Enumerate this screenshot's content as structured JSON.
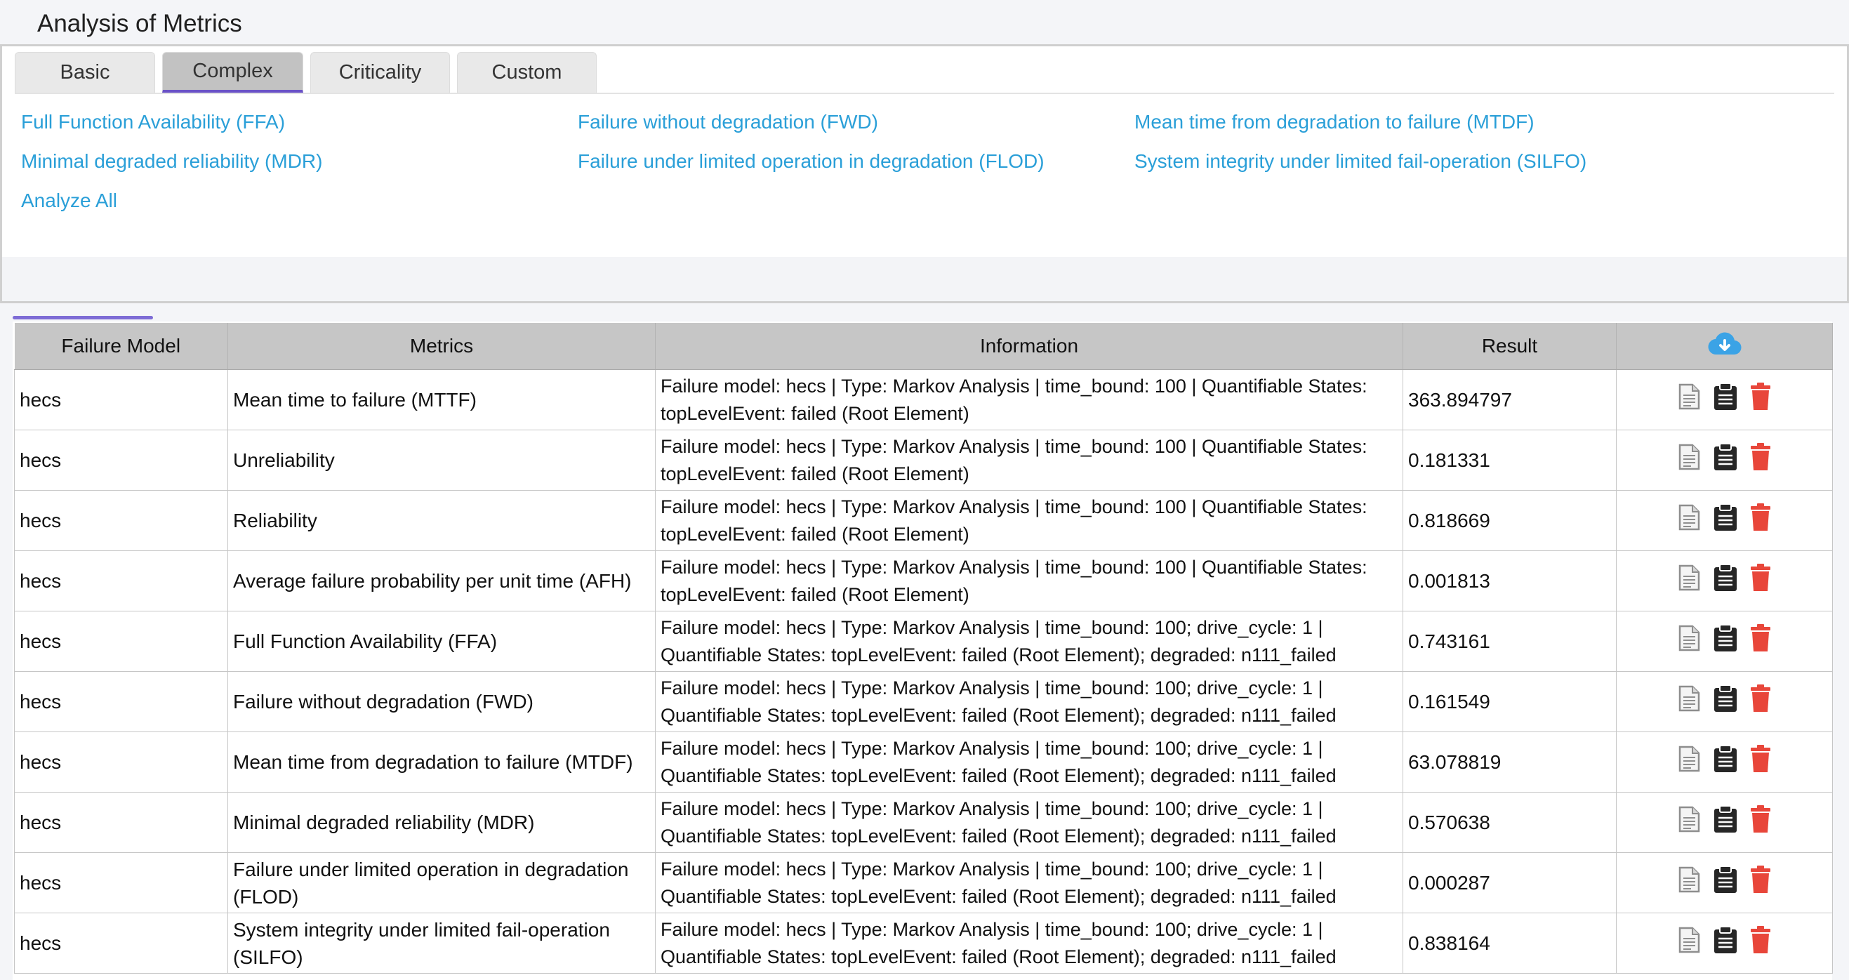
{
  "panel": {
    "title": "Analysis of Metrics"
  },
  "tabs": [
    {
      "label": "Basic"
    },
    {
      "label": "Complex"
    },
    {
      "label": "Criticality"
    },
    {
      "label": "Custom"
    }
  ],
  "links": [
    {
      "label": "Full Function Availability (FFA)"
    },
    {
      "label": "Failure without degradation (FWD)"
    },
    {
      "label": "Mean time from degradation to failure (MTDF)"
    },
    {
      "label": "Minimal degraded reliability (MDR)"
    },
    {
      "label": "Failure under limited operation in degradation (FLOD)"
    },
    {
      "label": "System integrity under limited fail-operation (SILFO)"
    },
    {
      "label": "Analyze All"
    }
  ],
  "table": {
    "headers": {
      "model": "Failure Model",
      "metrics": "Metrics",
      "info": "Information",
      "result": "Result",
      "download_icon": "cloud-download-icon"
    },
    "colors": {
      "download": "#3ba3e6",
      "delete": "#e8463a",
      "doc": "#8e8e8e",
      "clipboard": "#262626"
    },
    "rows": [
      {
        "model": "hecs",
        "metric": "Mean time to failure (MTTF)",
        "info1": "Failure model: hecs | Type: Markov Analysis | time_bound: 100 | Quantifiable States:",
        "info2": "topLevelEvent: failed (Root Element)",
        "result": "363.894797"
      },
      {
        "model": "hecs",
        "metric": "Unreliability",
        "info1": "Failure model: hecs | Type: Markov Analysis | time_bound: 100 | Quantifiable States:",
        "info2": "topLevelEvent: failed (Root Element)",
        "result": "0.181331"
      },
      {
        "model": "hecs",
        "metric": "Reliability",
        "info1": "Failure model: hecs | Type: Markov Analysis | time_bound: 100 | Quantifiable States:",
        "info2": "topLevelEvent: failed (Root Element)",
        "result": "0.818669"
      },
      {
        "model": "hecs",
        "metric": "Average failure probability per unit time (AFH)",
        "info1": "Failure model: hecs | Type: Markov Analysis | time_bound: 100 | Quantifiable States:",
        "info2": "topLevelEvent: failed (Root Element)",
        "result": "0.001813"
      },
      {
        "model": "hecs",
        "metric": "Full Function Availability (FFA)",
        "info1": "Failure model: hecs | Type: Markov Analysis | time_bound: 100; drive_cycle: 1 |",
        "info2": "Quantifiable States: topLevelEvent: failed (Root Element); degraded: n111_failed",
        "result": "0.743161"
      },
      {
        "model": "hecs",
        "metric": "Failure without degradation (FWD)",
        "info1": "Failure model: hecs | Type: Markov Analysis | time_bound: 100; drive_cycle: 1 |",
        "info2": "Quantifiable States: topLevelEvent: failed (Root Element); degraded: n111_failed",
        "result": "0.161549"
      },
      {
        "model": "hecs",
        "metric": "Mean time from degradation to failure (MTDF)",
        "info1": "Failure model: hecs | Type: Markov Analysis | time_bound: 100; drive_cycle: 1 |",
        "info2": "Quantifiable States: topLevelEvent: failed (Root Element); degraded: n111_failed",
        "result": "63.078819"
      },
      {
        "model": "hecs",
        "metric": "Minimal degraded reliability (MDR)",
        "info1": "Failure model: hecs | Type: Markov Analysis | time_bound: 100; drive_cycle: 1 |",
        "info2": "Quantifiable States: topLevelEvent: failed (Root Element); degraded: n111_failed",
        "result": "0.570638"
      },
      {
        "model": "hecs",
        "metric": "Failure under limited operation in degradation (FLOD)",
        "info1": "Failure model: hecs | Type: Markov Analysis | time_bound: 100; drive_cycle: 1 |",
        "info2": "Quantifiable States: topLevelEvent: failed (Root Element); degraded: n111_failed",
        "result": "0.000287"
      },
      {
        "model": "hecs",
        "metric": "System integrity under limited fail-operation (SILFO)",
        "info1": "Failure model: hecs | Type: Markov Analysis | time_bound: 100; drive_cycle: 1 |",
        "info2": "Quantifiable States: topLevelEvent: failed (Root Element); degraded: n111_failed",
        "result": "0.838164"
      }
    ],
    "row_action_icons": [
      "document-icon",
      "clipboard-icon",
      "trash-icon"
    ]
  }
}
